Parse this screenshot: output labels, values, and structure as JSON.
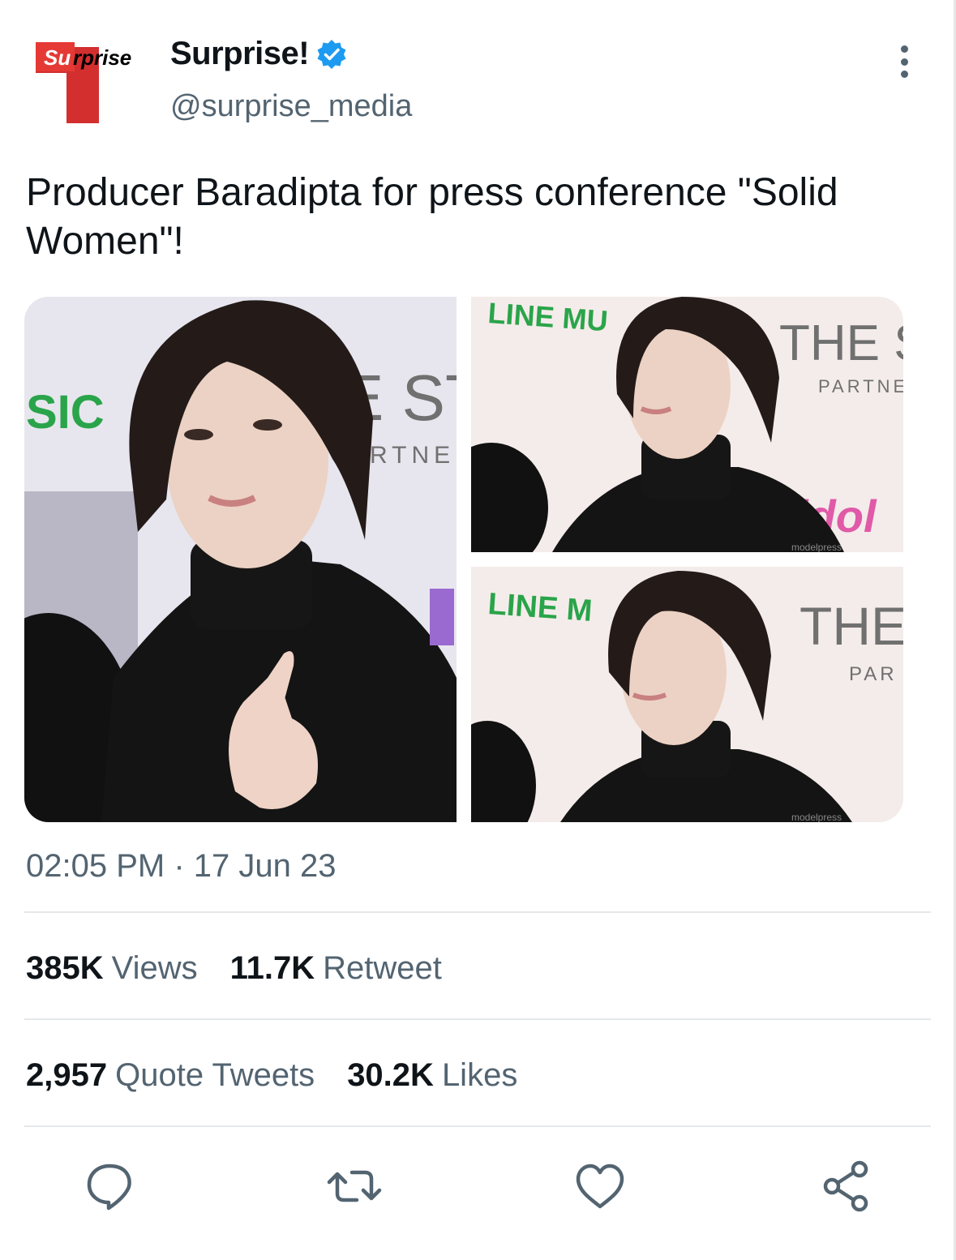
{
  "header": {
    "logo_text": "Surprise",
    "display_name": "Surprise!",
    "handle": "@surprise_media"
  },
  "tweet": {
    "text": "Producer Baradipta for press conference \"Solid Women\"!",
    "timestamp": "02:05 PM · 17 Jun 23"
  },
  "photos": [
    {
      "backdrop_texts": [
        "SIC",
        "E ST",
        "ARTNE"
      ]
    },
    {
      "backdrop_texts": [
        "LINE MU",
        "THE S",
        "PARTNE",
        "idol",
        "modelpress"
      ]
    },
    {
      "backdrop_texts": [
        "LINE M",
        "THE",
        "PAR",
        "modelpress"
      ]
    }
  ],
  "stats_row1": [
    {
      "value": "385K",
      "label": "Views"
    },
    {
      "value": "11.7K",
      "label": "Retweet"
    }
  ],
  "stats_row2": [
    {
      "value": "2,957",
      "label": "Quote Tweets"
    },
    {
      "value": "30.2K",
      "label": "Likes"
    }
  ],
  "actions": [
    "reply",
    "retweet",
    "like",
    "share"
  ],
  "colors": {
    "verified": "#1d9bf0",
    "secondary_text": "#536471",
    "logo_red": "#e53935",
    "divider": "#e4e8eb"
  }
}
